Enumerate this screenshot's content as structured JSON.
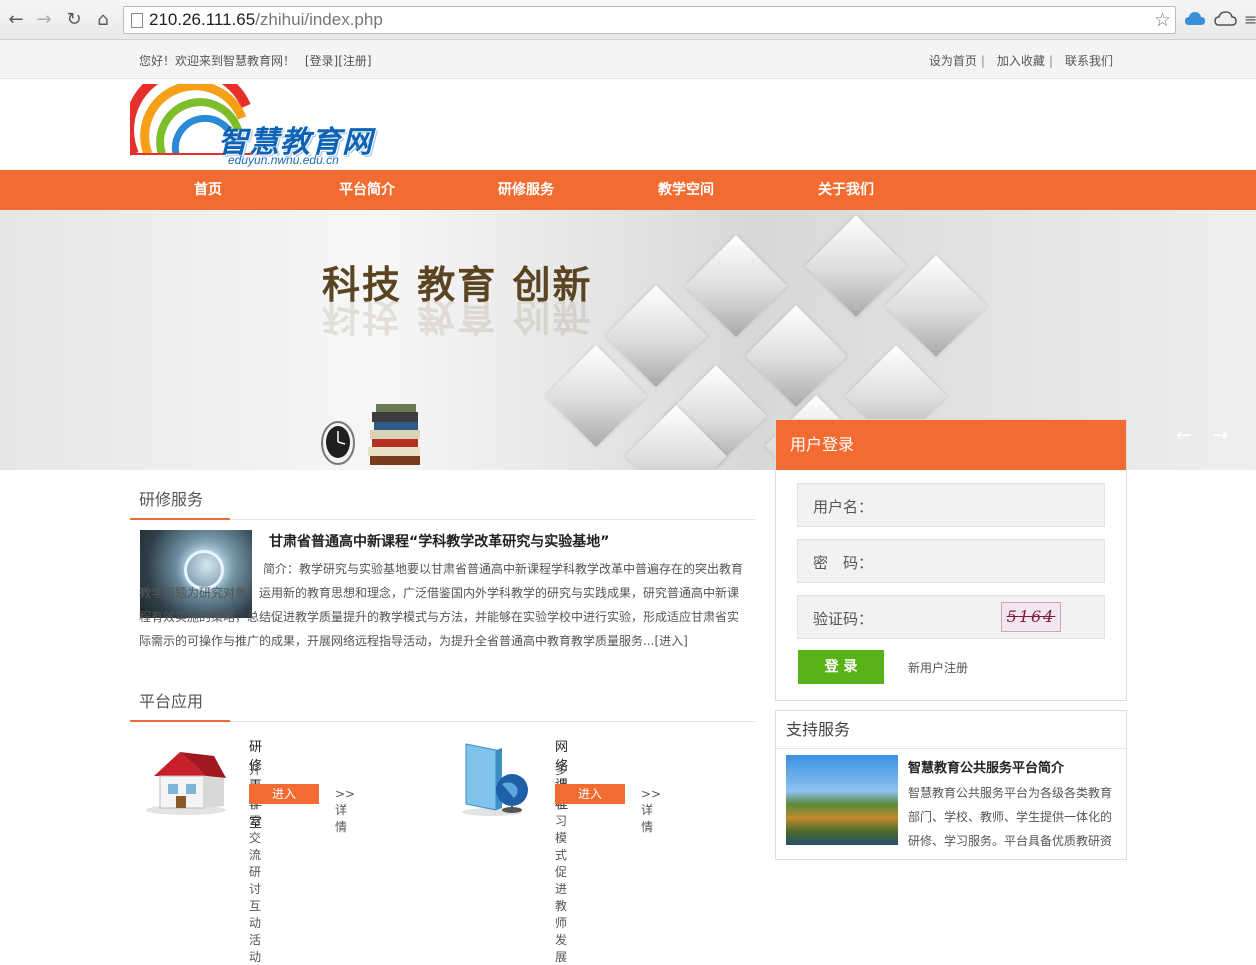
{
  "browser": {
    "url_host": "210.26.111.65",
    "url_path": "/zhihui/index.php",
    "back_icon": "←",
    "forward_icon": "→",
    "reload_icon": "↻",
    "home_icon": "⌂",
    "star_icon": "☆"
  },
  "topbar": {
    "welcome": "您好！欢迎来到智慧教育网！",
    "login_link": "[登录]",
    "register_link": "[注册]",
    "links": [
      "设为首页",
      "加入收藏",
      "联系我们"
    ],
    "separator": "|"
  },
  "logo": {
    "title": "智慧教育网",
    "sub": "eduyun.nwnu.edu.cn"
  },
  "nav": {
    "items": [
      "首页",
      "平台简介",
      "研修服务",
      "教学空间",
      "关于我们"
    ]
  },
  "banner": {
    "slogan": "科技  教育  创新",
    "arrows": "← →"
  },
  "login": {
    "title": "用户登录",
    "username_label": "用户名：",
    "password_label": "密　码：",
    "captcha_label": "验证码：",
    "captcha_text": "5164",
    "submit": "登 录",
    "register": "新用户注册"
  },
  "support": {
    "title": "支持服务",
    "item_title": "智慧教育公共服务平台简介",
    "item_desc": "智慧教育公共服务平台为各级各类教育部门、学校、教师、学生提供一体化的研修、学习服务。平台具备优质教研资"
  },
  "training": {
    "section_title": "研修服务",
    "article_title": "甘肃省普通高中新课程“学科教学改革研究与实验基地”",
    "article_desc": "简介：教学研究与实验基地要以甘肃省普通高中新课程学科教学改革中普遍存在的突出教育教学问题为研究对象，运用新的教育思想和理念，广泛借鉴国内外学科教学的研究与实践成果，研究普通高中新课程有效实施的策略，总结促进教学质量提升的教学模式与方法，并能够在实验学校中进行实验，形成适应甘肃省实际需示的可操作与推广的成果，开展网络远程指导活动，为提升全省普通高中教育教学质量服务...",
    "read_more": "[进入]"
  },
  "apps": {
    "section_title": "平台应用",
    "items": [
      {
        "name": "研修工作室",
        "tag": "开展学习交流 研讨互动活动",
        "enter": "进入",
        "more": ">>详情"
      },
      {
        "name": "网络课程",
        "tag": "多种学习模式 促进教师发展",
        "enter": "进入",
        "more": ">>详情"
      }
    ]
  },
  "colors": {
    "accent": "#f26c32",
    "button_green": "#5ab21a",
    "logo_blue": "#0f63b5"
  }
}
